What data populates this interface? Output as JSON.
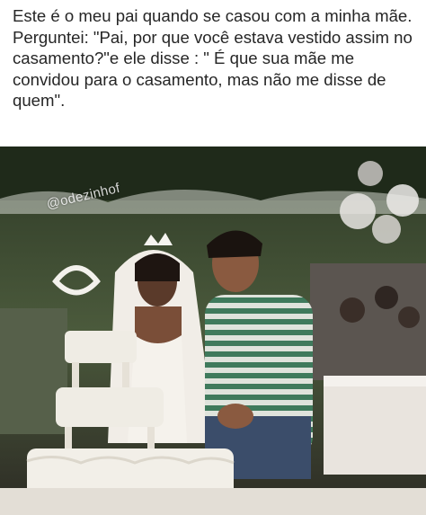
{
  "post": {
    "caption_lines": [
      "Este é o meu pai quando se casou com a minha mãe.",
      "Perguntei: \"Pai, por que você estava vestido assim no casamento?\"e ele disse : \" É que sua mãe me convidou para o casamento, mas não me disse de quem\"."
    ],
    "watermark": "@odezinhof"
  },
  "photo": {
    "subject": "wedding-photo",
    "colors": {
      "foliage": "#3d4a32",
      "tablecloth": "#e9e4de",
      "shirt_green": "#3f7a5c",
      "shirt_stripe": "#dfe3dc",
      "cake": "#efece4"
    }
  }
}
